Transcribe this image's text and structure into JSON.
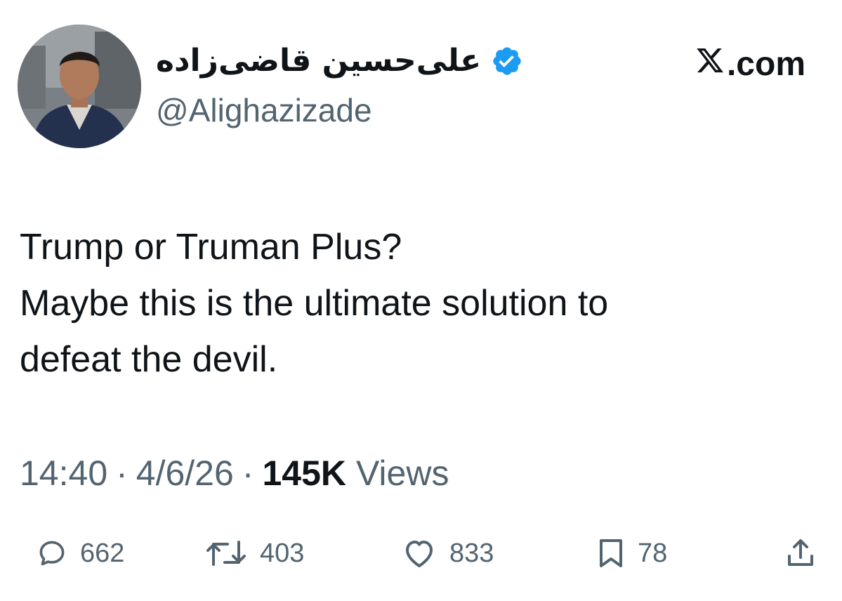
{
  "author": {
    "display_name": "علی‌حسین قاضی‌زاده",
    "handle": "@Alighazizade",
    "verified": true
  },
  "brand": {
    "label": ".com",
    "logo_icon": "x-logo-icon"
  },
  "tweet": {
    "lines": [
      "Trump or Truman Plus?",
      "Maybe this is the ultimate solution to",
      "defeat the devil."
    ]
  },
  "meta": {
    "time": "14:40",
    "separator": "·",
    "date": "4/6/26",
    "views_count": "145K",
    "views_label": "Views"
  },
  "actions": {
    "replies": "662",
    "reposts": "403",
    "likes": "833",
    "bookmarks": "78"
  },
  "colors": {
    "text": "#0f1419",
    "secondary": "#536471",
    "verified_blue": "#1d9bf0"
  }
}
